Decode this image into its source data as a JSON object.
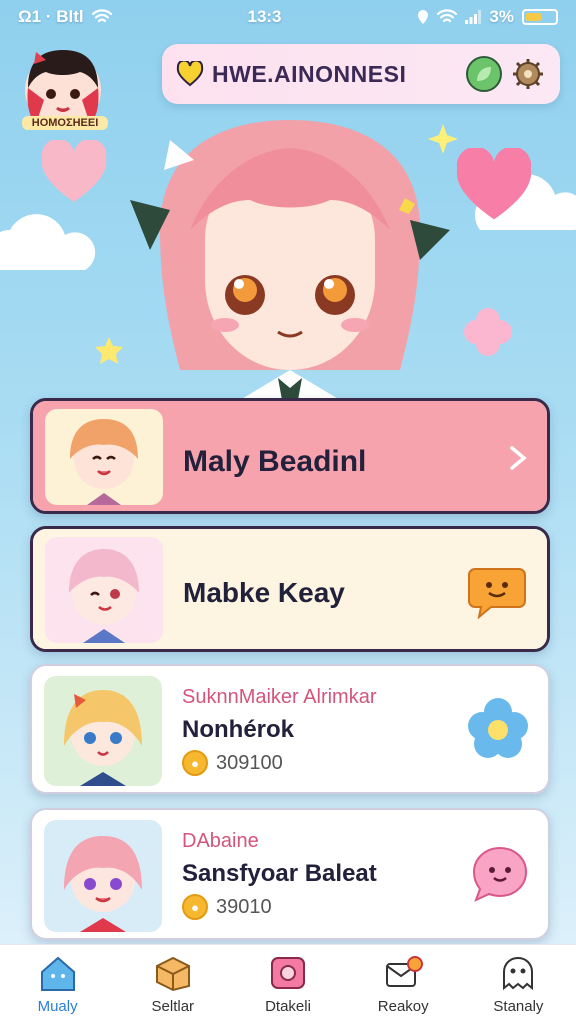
{
  "status_bar": {
    "left": "Ω1 · Βltl",
    "time": "13:3",
    "battery": "3%",
    "battery_level": 0.55
  },
  "header": {
    "avatar_caption": "ΗΟΜΟΣΗΕΕΙ",
    "title": "HWE.AINONNESI"
  },
  "cards": [
    {
      "title": "Maly Beadinl",
      "icon": "chevron-right-icon",
      "color": "#f6a3ad"
    },
    {
      "title": "Mabke Keay",
      "icon": "smiley-bubble-icon",
      "color": "#fdf5e2"
    },
    {
      "subtitle": "SuknnMaiker Alrimkar",
      "title": "Nonhérok",
      "coins": "309100",
      "icon": "flower-icon",
      "color": "#ffffff"
    },
    {
      "subtitle": "DAbaine",
      "title": "Sansfyoar Baleat",
      "coins": "39010",
      "icon": "pink-bubble-icon",
      "color": "#ffffff"
    }
  ],
  "nav": [
    {
      "label": "Mualy",
      "icon": "home-icon",
      "active": true
    },
    {
      "label": "Seltlar",
      "icon": "box-icon",
      "active": false
    },
    {
      "label": "Dtakeli",
      "icon": "camera-icon",
      "active": false
    },
    {
      "label": "Reakoy",
      "icon": "letter-icon",
      "active": false
    },
    {
      "label": "Stanaly",
      "icon": "ghost-icon",
      "active": false
    }
  ]
}
